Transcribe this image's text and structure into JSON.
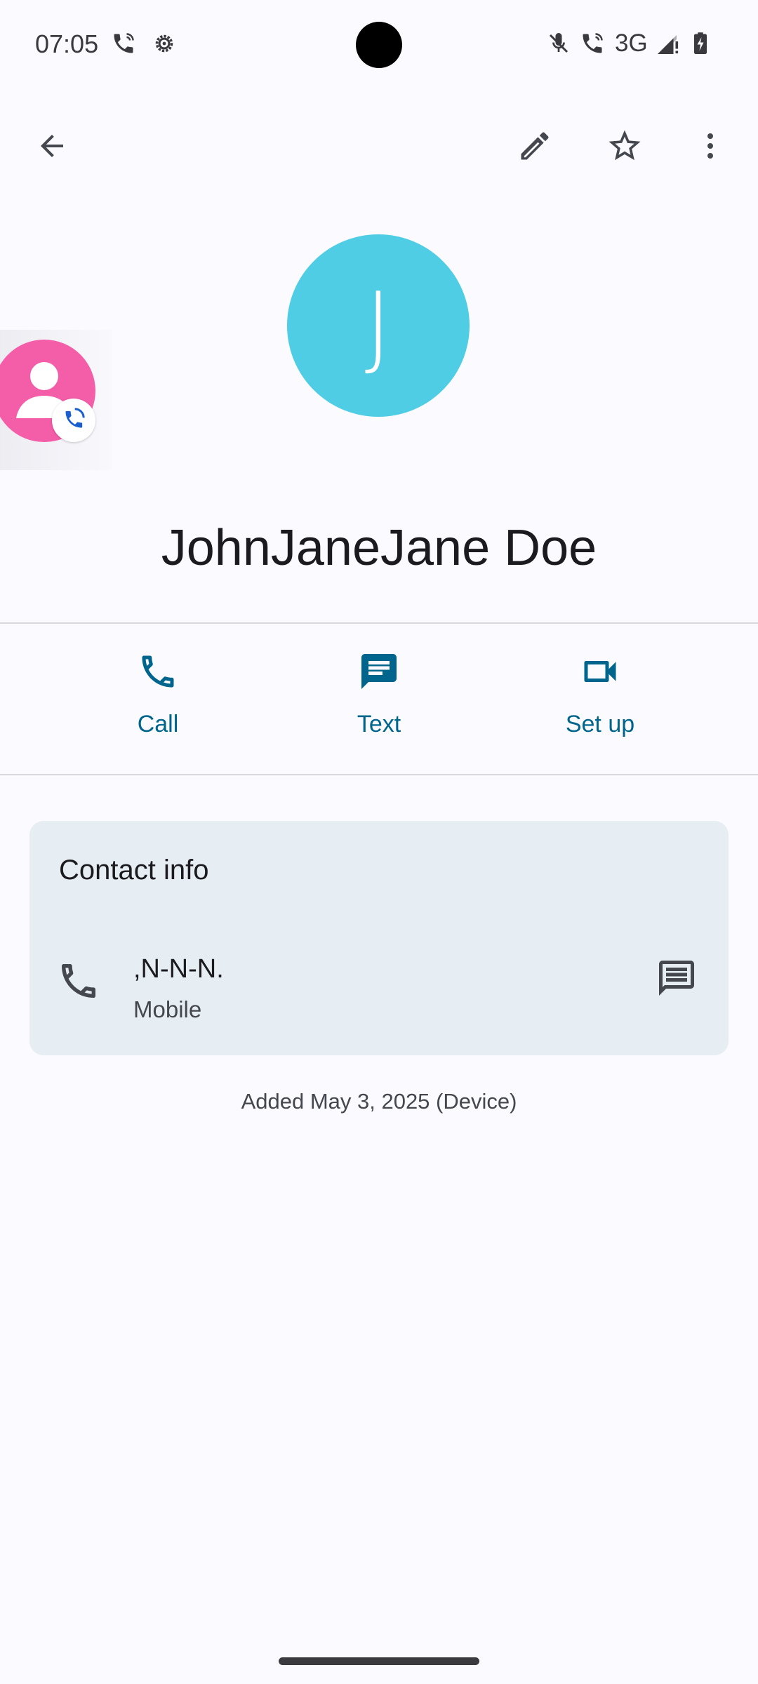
{
  "status_bar": {
    "time": "07:05",
    "network": "3G",
    "icons": [
      "wifi-call-icon",
      "settings-gear-icon",
      "mic-off-icon",
      "wifi-call-icon",
      "signal-icon",
      "battery-charging-icon"
    ]
  },
  "app_bar": {
    "icons": [
      "back-arrow-icon",
      "edit-pencil-icon",
      "star-outline-icon",
      "more-vert-icon"
    ]
  },
  "contact": {
    "initial": "J",
    "name": "JohnJaneJane Doe",
    "avatar_color": "#4fcde4"
  },
  "actions": [
    {
      "label": "Call",
      "icon": "phone-icon"
    },
    {
      "label": "Text",
      "icon": "message-icon"
    },
    {
      "label": "Set up",
      "icon": "video-icon"
    }
  ],
  "contact_info": {
    "title": "Contact info",
    "phone": {
      "number": ",N-N-N.",
      "type": "Mobile"
    }
  },
  "footer": {
    "added": "Added May 3, 2025 (Device)"
  },
  "colors": {
    "accent": "#00658c",
    "background": "#fbfaff",
    "card": "#e6edf3",
    "bubble": "#f45da8"
  }
}
